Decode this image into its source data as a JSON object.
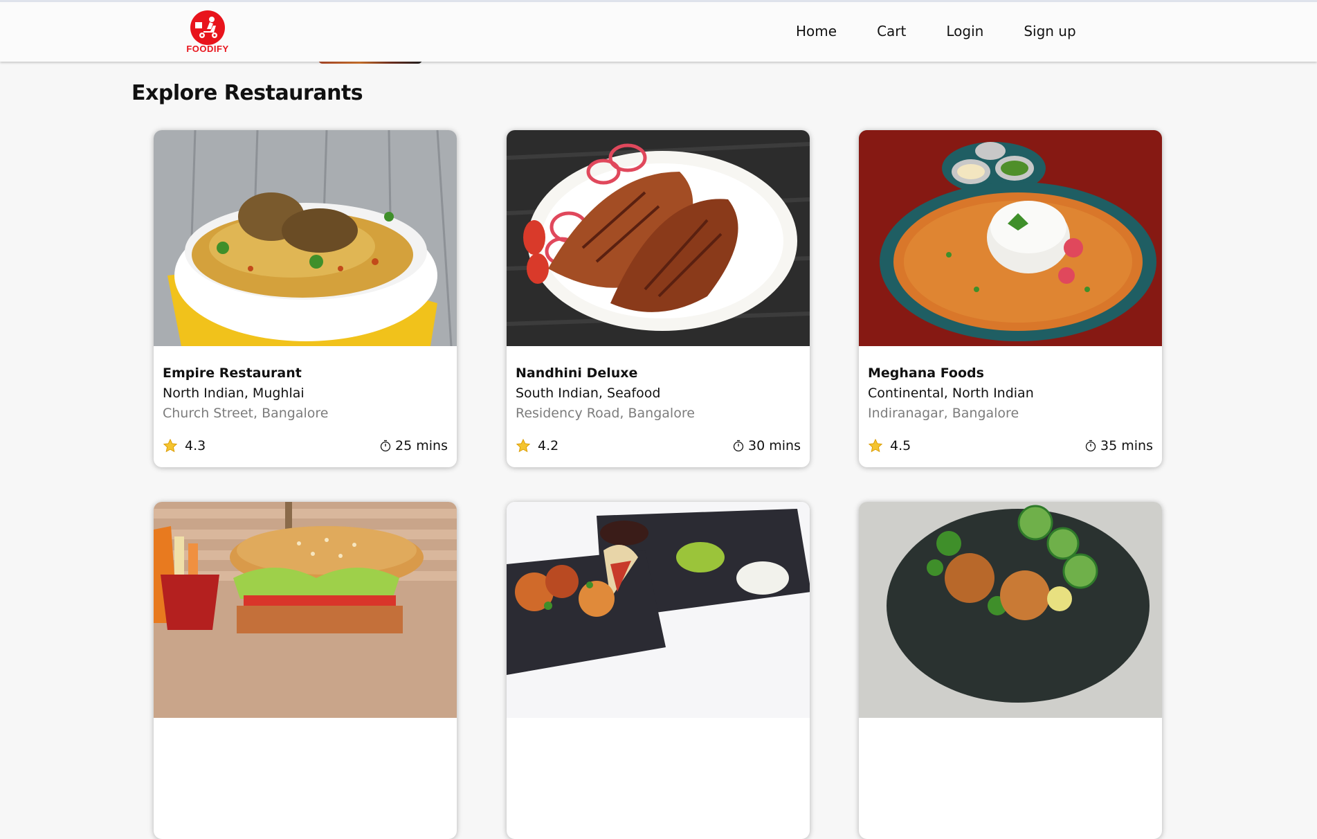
{
  "brand": {
    "name": "FOODIFY",
    "logo_icon": "delivery-scooter-icon",
    "color": "#e8141c"
  },
  "nav": {
    "links": [
      "Home",
      "Cart",
      "Login",
      "Sign up"
    ]
  },
  "page": {
    "title": "Explore Restaurants"
  },
  "restaurants": [
    {
      "name": "Empire Restaurant",
      "cuisine": "North Indian, Mughlai",
      "address": "Church Street, Bangalore",
      "rating": "4.3",
      "eta": "25 mins",
      "image": "biryani-bowl"
    },
    {
      "name": "Nandhini Deluxe",
      "cuisine": "South Indian, Seafood",
      "address": "Residency Road, Bangalore",
      "rating": "4.2",
      "eta": "30 mins",
      "image": "fried-fish-plate"
    },
    {
      "name": "Meghana Foods",
      "cuisine": "Continental, North Indian",
      "address": "Indiranagar, Bangalore",
      "rating": "4.5",
      "eta": "35 mins",
      "image": "curry-rice-plate"
    },
    {
      "image": "burger-fries"
    },
    {
      "image": "kebab-platter"
    },
    {
      "image": "salad-bowl"
    }
  ],
  "icons": {
    "rating": "star-icon",
    "eta": "timer-icon"
  },
  "colors": {
    "star": "#f4c430",
    "address": "#7c7c7c",
    "background": "#f7f7f7"
  }
}
